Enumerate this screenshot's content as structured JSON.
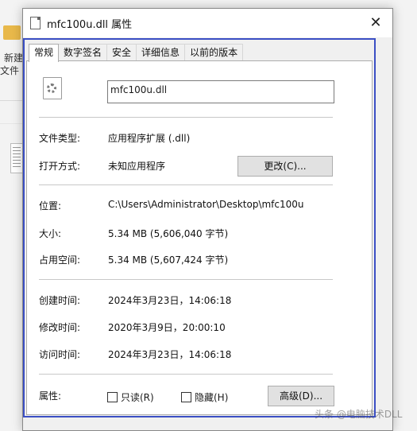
{
  "background": {
    "folder_label_1": "新建",
    "folder_label_2": "文件"
  },
  "window": {
    "title": "mfc100u.dll 属性",
    "close_glyph": "✕"
  },
  "tabs": [
    {
      "label": "常规",
      "active": true
    },
    {
      "label": "数字签名",
      "active": false
    },
    {
      "label": "安全",
      "active": false
    },
    {
      "label": "详细信息",
      "active": false
    },
    {
      "label": "以前的版本",
      "active": false
    }
  ],
  "general": {
    "file_name": "mfc100u.dll",
    "file_type_label": "文件类型:",
    "file_type_value": "应用程序扩展 (.dll)",
    "open_with_label": "打开方式:",
    "open_with_value": "未知应用程序",
    "change_button": "更改(C)...",
    "location_label": "位置:",
    "location_value": "C:\\Users\\Administrator\\Desktop\\mfc100u",
    "size_label": "大小:",
    "size_value": "5.34 MB (5,606,040 字节)",
    "disk_size_label": "占用空间:",
    "disk_size_value": "5.34 MB (5,607,424 字节)",
    "created_label": "创建时间:",
    "created_value": "2024年3月23日，14:06:18",
    "modified_label": "修改时间:",
    "modified_value": "2020年3月9日，20:00:10",
    "accessed_label": "访问时间:",
    "accessed_value": "2024年3月23日，14:06:18",
    "attributes_label": "属性:",
    "readonly_label": "只读(R)",
    "readonly_checked": false,
    "hidden_label": "隐藏(H)",
    "hidden_checked": false,
    "advanced_button": "高级(D)..."
  },
  "watermark": "头条 @电脑技术DLL",
  "colors": {
    "highlight_frame": "#3b4fc4",
    "button_bg": "#e1e1e1",
    "panel_bg": "#ffffff"
  }
}
